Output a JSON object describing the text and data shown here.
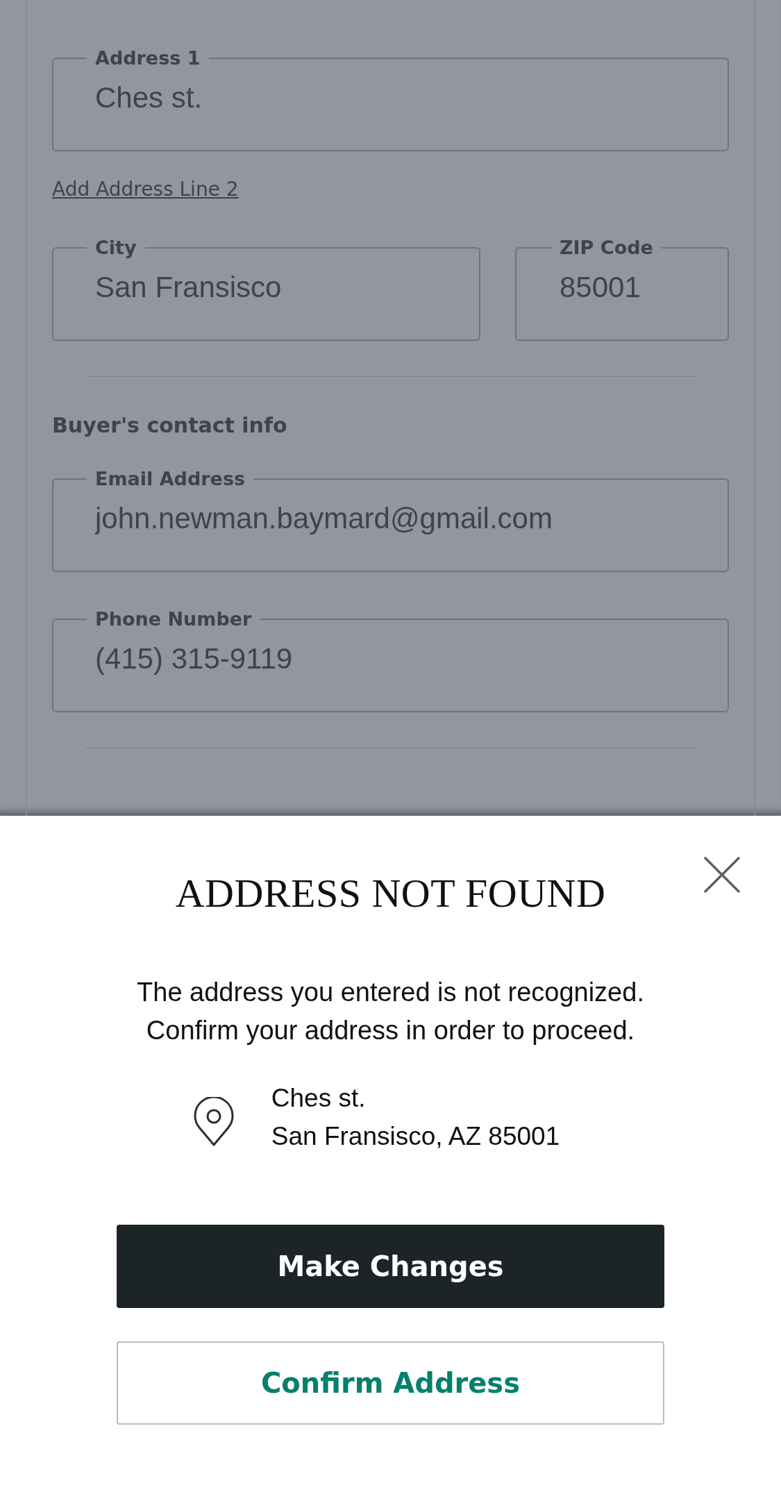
{
  "form": {
    "address_1": {
      "label": "Address 1",
      "value": "Ches st."
    },
    "add_line_2_link": "Add Address Line 2",
    "city": {
      "label": "City",
      "value": "San Fransisco"
    },
    "zip": {
      "label": "ZIP Code",
      "value": "85001"
    },
    "contact_heading": "Buyer's contact info",
    "email": {
      "label": "Email Address",
      "value": "john.newman.baymard@gmail.com"
    },
    "phone": {
      "label": "Phone Number",
      "value": "(415) 315-9119"
    }
  },
  "dialog": {
    "title": "ADDRESS NOT FOUND",
    "message_lines": [
      "The address you entered is not recognized.",
      "Confirm your address in order to proceed."
    ],
    "address_lines": [
      "Ches st.",
      "San Fransisco, AZ 85001"
    ],
    "primary_button": "Make Changes",
    "secondary_button": "Confirm Address"
  }
}
